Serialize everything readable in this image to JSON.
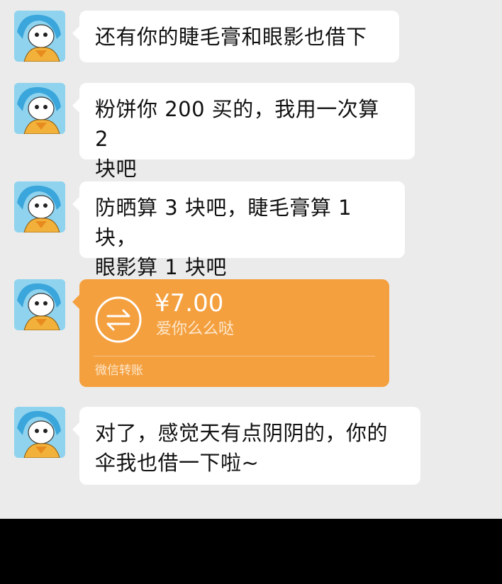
{
  "messages": [
    {
      "type": "text",
      "lines": [
        "还有你的睫毛膏和眼影也借下"
      ]
    },
    {
      "type": "text",
      "lines": [
        "粉饼你 200 买的，我用一次算 2",
        "块吧"
      ]
    },
    {
      "type": "text",
      "lines": [
        "防晒算 3 块吧，睫毛膏算 1 块，",
        "眼影算 1 块吧"
      ]
    },
    {
      "type": "transfer",
      "amount": "¥7.00",
      "note": "爱你么么哒",
      "footer": "微信转账",
      "icon": "transfer-arrows-icon"
    },
    {
      "type": "text",
      "lines": [
        "对了，感觉天有点阴阴的，你的",
        "伞我也借一下啦~"
      ]
    }
  ],
  "colors": {
    "chat_background": "#ebebeb",
    "bubble_background": "#ffffff",
    "transfer_background": "#f4a03f",
    "avatar_background": "#8fd3ee"
  }
}
